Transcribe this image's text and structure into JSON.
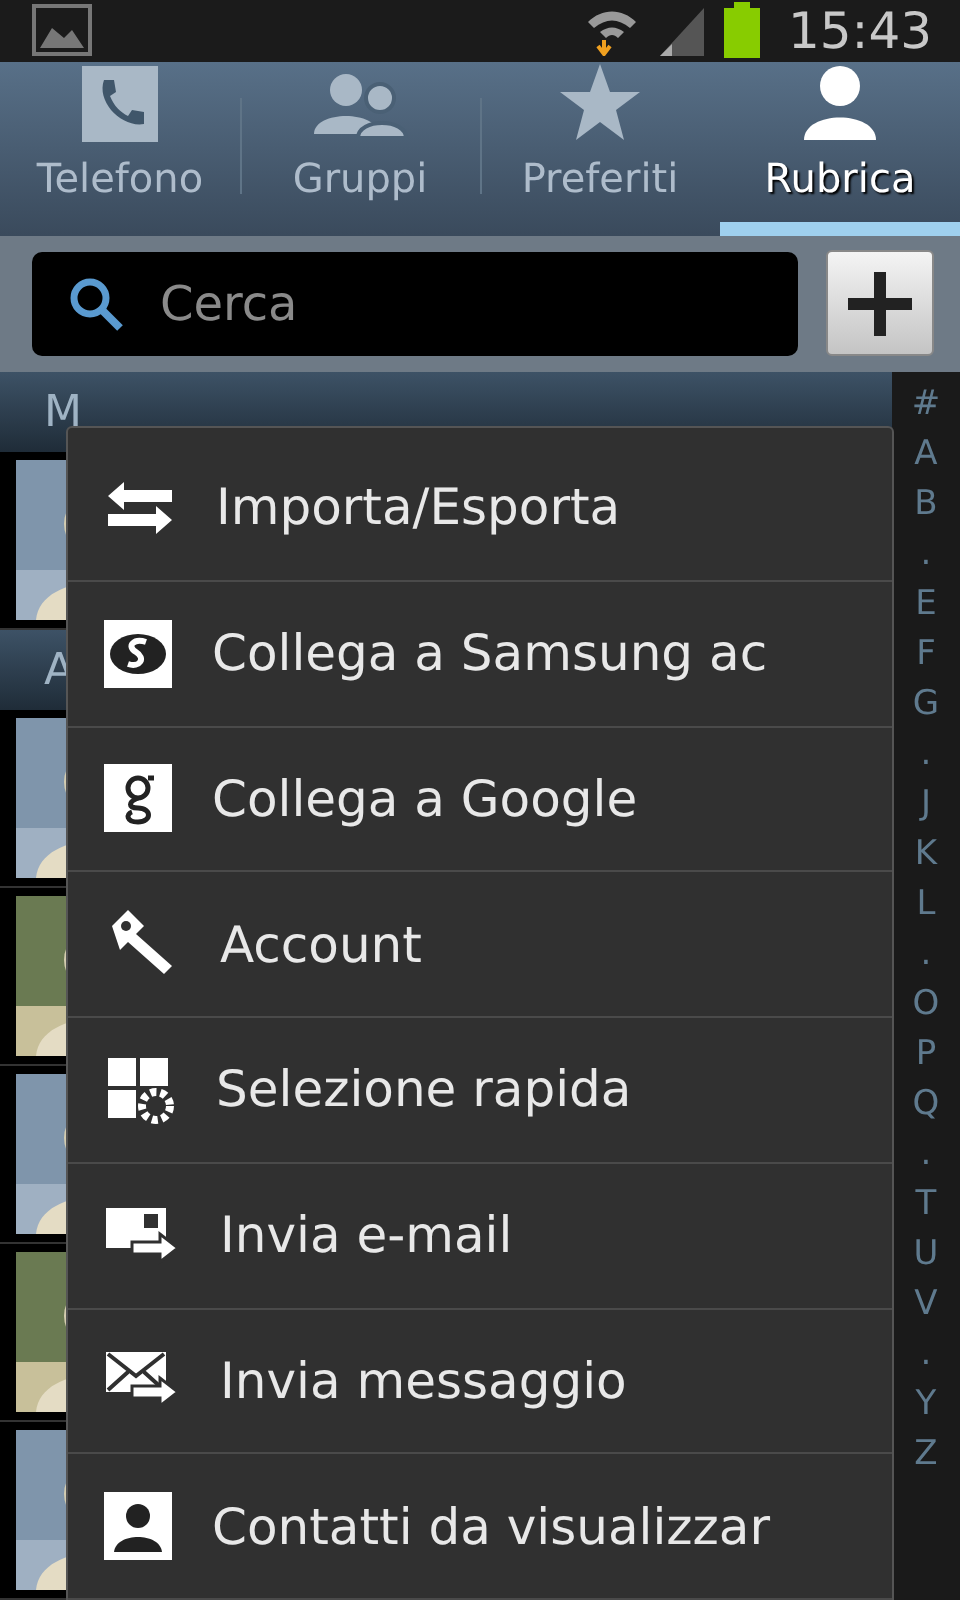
{
  "status_bar": {
    "time": "15:43"
  },
  "tabs": [
    {
      "label": "Telefono",
      "selected": false
    },
    {
      "label": "Gruppi",
      "selected": false
    },
    {
      "label": "Preferiti",
      "selected": false
    },
    {
      "label": "Rubrica",
      "selected": true
    }
  ],
  "search": {
    "placeholder": "Cerca"
  },
  "contacts": [
    {
      "kind": "header",
      "letter": "M"
    },
    {
      "kind": "picture"
    },
    {
      "kind": "header",
      "letter": "A"
    },
    {
      "kind": "picture"
    },
    {
      "kind": "picture"
    },
    {
      "kind": "picture"
    },
    {
      "kind": "picture"
    },
    {
      "kind": "picture"
    }
  ],
  "index": [
    "#",
    "A",
    "B",
    ".",
    "E",
    "F",
    "G",
    ".",
    "J",
    "K",
    "L",
    ".",
    "O",
    "P",
    "Q",
    ".",
    "T",
    "U",
    "V",
    ".",
    "Y",
    "Z"
  ],
  "menu": [
    {
      "label": "Importa/Esporta"
    },
    {
      "label": "Collega a Samsung ac"
    },
    {
      "label": "Collega a Google"
    },
    {
      "label": "Account"
    },
    {
      "label": "Selezione rapida"
    },
    {
      "label": "Invia e-mail"
    },
    {
      "label": "Invia messaggio"
    },
    {
      "label": "Contatti da visualizzar"
    }
  ]
}
